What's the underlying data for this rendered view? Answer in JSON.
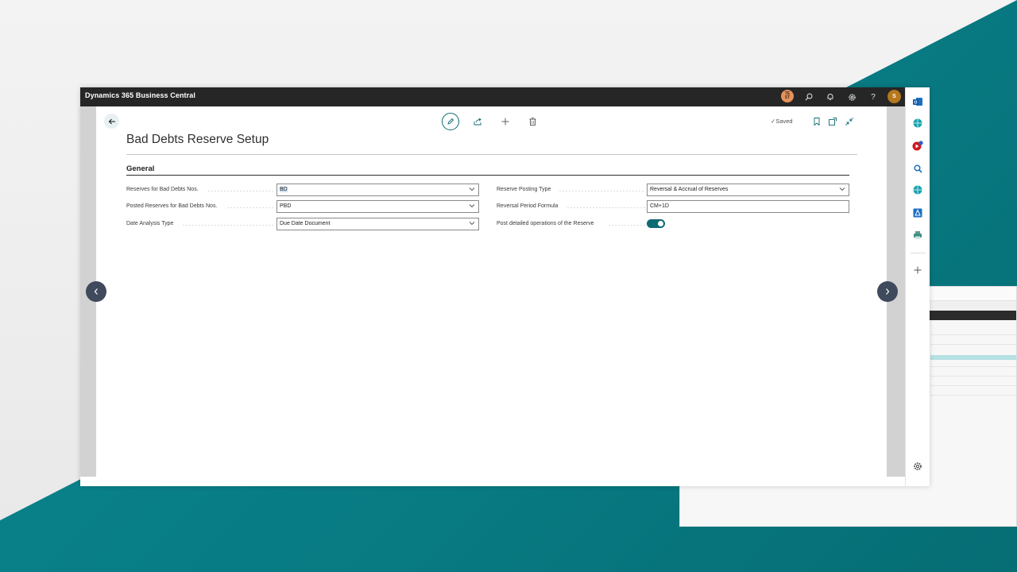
{
  "app": {
    "title": "Dynamics 365 Business Central",
    "user_initials_test": "TE\nST",
    "user_initial": "S"
  },
  "topbar": {
    "icons": [
      "search-icon",
      "bell-icon",
      "gear-icon",
      "help-icon"
    ],
    "help_label": "?"
  },
  "actions": {
    "saved_label": "✓Saved"
  },
  "page": {
    "title": "Bad Debts Reserve Setup",
    "section": "General"
  },
  "fields": {
    "reserves_nos": {
      "label": "Reserves for Bad Debts Nos.",
      "value": "BD"
    },
    "posted_reserves_nos": {
      "label": "Posted Reserves for Bad Debts Nos.",
      "value": "PBD"
    },
    "date_analysis_type": {
      "label": "Date Analysis Type",
      "value": "Due Date Document"
    },
    "reserve_posting_type": {
      "label": "Reserve Posting Type",
      "value": "Reversal & Accrual of Reserves"
    },
    "reversal_period_formula": {
      "label": "Reversal Period Formula",
      "value": "CM+1D"
    },
    "post_detailed_operations": {
      "label": "Post detailed operations of the Reserve",
      "enabled": true
    }
  },
  "colors": {
    "accent": "#0e6a73",
    "topbar": "#262626",
    "teal_background": "#087a82"
  },
  "side_panel": {
    "icons": [
      "outlook-icon",
      "teams-icon",
      "youtube-icon",
      "search-icon",
      "teams-icon",
      "azure-icon",
      "printer-icon",
      "add-icon",
      "settings-icon"
    ]
  }
}
